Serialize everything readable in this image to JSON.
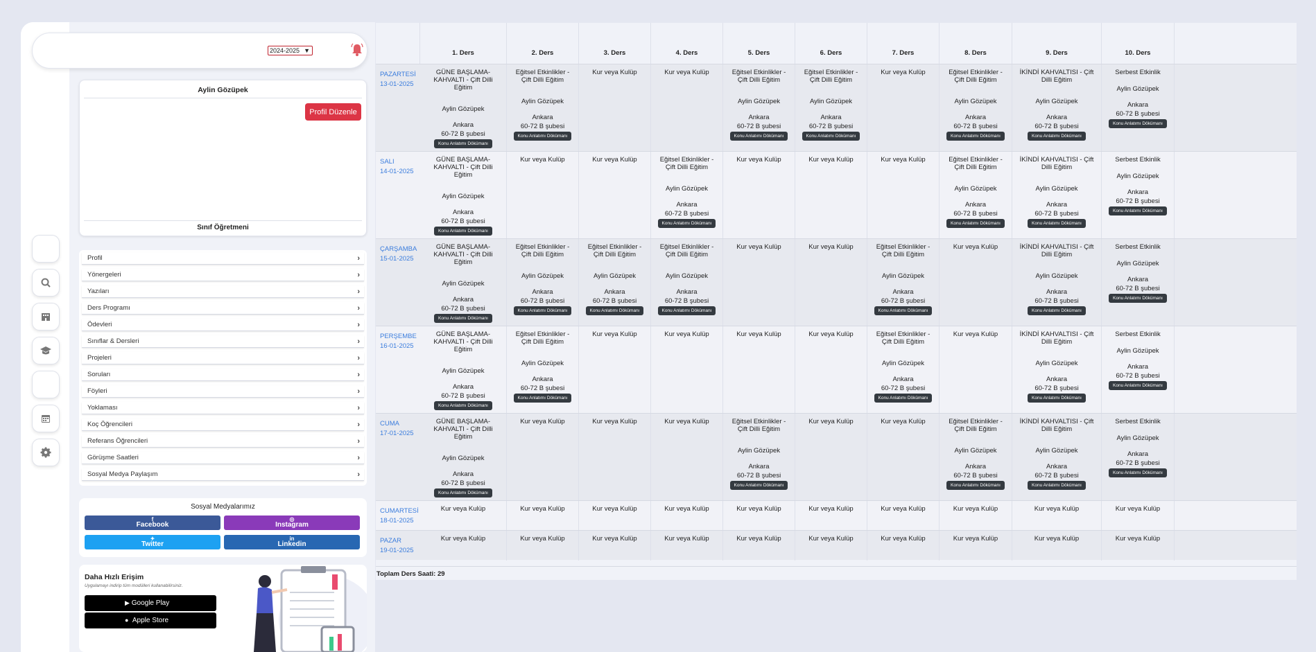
{
  "header": {
    "year": "2024-2025"
  },
  "profile": {
    "name": "Aylin Gözüpek",
    "edit_label": "Profil Düzenle",
    "role": "Sınıf Öğretmeni"
  },
  "menu": [
    "Profil",
    "Yönergeleri",
    "Yazıları",
    "Ders Programı",
    "Ödevleri",
    "Sınıflar & Dersleri",
    "Projeleri",
    "Soruları",
    "Föyleri",
    "Yoklaması",
    "Koç Öğrencileri",
    "Referans Öğrencileri",
    "Görüşme Saatleri",
    "Sosyal Medya Paylaşım"
  ],
  "social": {
    "title": "Sosyal Medyalarımız",
    "facebook": "Facebook",
    "instagram": "Instagram",
    "twitter": "Twitter",
    "linkedin": "Linkedin",
    "colors": {
      "facebook": "#3b5998",
      "instagram": "#8a3ab9",
      "twitter": "#1da1f2",
      "linkedin": "#2867b2"
    }
  },
  "fast_access": {
    "title": "Daha Hızlı Erişim",
    "subtitle": "Uygulamayı indirip tüm modülleri kullanabilirsiniz.",
    "google_play": "Google Play",
    "apple_store": "Apple Store"
  },
  "schedule": {
    "headers": [
      "1. Ders",
      "2. Ders",
      "3. Ders",
      "4. Ders",
      "5. Ders",
      "6. Ders",
      "7. Ders",
      "8. Ders",
      "9. Ders",
      "10. Ders"
    ],
    "badge": "Konu Anlatımı Dökümanı",
    "teacher": "Aylin Gözüpek",
    "city": "Ankara",
    "branch": "60-72 B şubesi",
    "default_text": "Kur veya Kulüp",
    "total": "Toplam Ders Saati: 29",
    "days": [
      {
        "name": "PAZARTESİ",
        "date": "13-01-2025",
        "cells": [
          "GÜNE BAŞLAMA-KAHVALTI - Çift Dilli Eğitim",
          "Eğitsel Etkinlikler - Çift Dilli Eğitim",
          "",
          "",
          "Eğitsel Etkinlikler - Çift Dilli Eğitim",
          "Eğitsel Etkinlikler - Çift Dilli Eğitim",
          "",
          "Eğitsel Etkinlikler - Çift Dilli Eğitim",
          "İKİNDİ KAHVALTISI - Çift Dilli Eğitim",
          "Serbest Etkinlik"
        ]
      },
      {
        "name": "SALI",
        "date": "14-01-2025",
        "cells": [
          "GÜNE BAŞLAMA-KAHVALTI - Çift Dilli Eğitim",
          "",
          "",
          "Eğitsel Etkinlikler - Çift Dilli Eğitim",
          "",
          "",
          "",
          "Eğitsel Etkinlikler - Çift Dilli Eğitim",
          "İKİNDİ KAHVALTISI - Çift Dilli Eğitim",
          "Serbest Etkinlik"
        ]
      },
      {
        "name": "ÇARŞAMBA",
        "date": "15-01-2025",
        "cells": [
          "GÜNE BAŞLAMA-KAHVALTI - Çift Dilli Eğitim",
          "Eğitsel Etkinlikler - Çift Dilli Eğitim",
          "Eğitsel Etkinlikler - Çift Dilli Eğitim",
          "Eğitsel Etkinlikler - Çift Dilli Eğitim",
          "",
          "",
          "Eğitsel Etkinlikler - Çift Dilli Eğitim",
          "",
          "İKİNDİ KAHVALTISI - Çift Dilli Eğitim",
          "Serbest Etkinlik"
        ]
      },
      {
        "name": "PERŞEMBE",
        "date": "16-01-2025",
        "cells": [
          "GÜNE BAŞLAMA-KAHVALTI - Çift Dilli Eğitim",
          "Eğitsel Etkinlikler - Çift Dilli Eğitim",
          "",
          "",
          "",
          "",
          "Eğitsel Etkinlikler - Çift Dilli Eğitim",
          "",
          "İKİNDİ KAHVALTISI - Çift Dilli Eğitim",
          "Serbest Etkinlik"
        ]
      },
      {
        "name": "CUMA",
        "date": "17-01-2025",
        "cells": [
          "GÜNE BAŞLAMA-KAHVALTI - Çift Dilli Eğitim",
          "",
          "",
          "",
          "Eğitsel Etkinlikler - Çift Dilli Eğitim",
          "",
          "",
          "Eğitsel Etkinlikler - Çift Dilli Eğitim",
          "İKİNDİ KAHVALTISI - Çift Dilli Eğitim",
          "Serbest Etkinlik"
        ]
      },
      {
        "name": "CUMARTESİ",
        "date": "18-01-2025",
        "cells": [
          "",
          "",
          "",
          "",
          "",
          "",
          "",
          "",
          "",
          ""
        ]
      },
      {
        "name": "PAZAR",
        "date": "19-01-2025",
        "cells": [
          "",
          "",
          "",
          "",
          "",
          "",
          "",
          "",
          "",
          ""
        ]
      }
    ]
  }
}
